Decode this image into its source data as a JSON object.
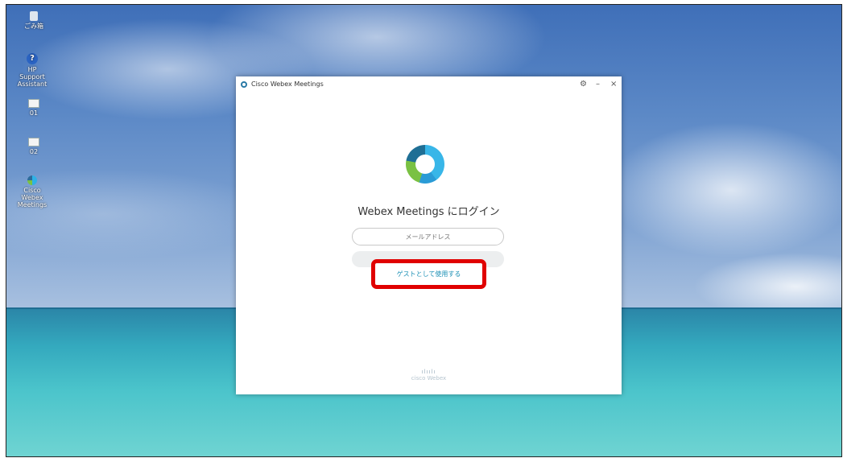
{
  "desktop": {
    "icons": [
      {
        "label": "ごみ箱",
        "icon": "recycle-bin-icon"
      },
      {
        "label": "HP Support Assistant",
        "icon": "help-icon"
      },
      {
        "label": "01",
        "icon": "file-icon"
      },
      {
        "label": "02",
        "icon": "file-icon"
      },
      {
        "label": "Cisco Webex Meetings",
        "icon": "webex-icon"
      }
    ]
  },
  "window": {
    "title": "Cisco Webex Meetings",
    "controls": {
      "settings": "⚙",
      "minimize": "–",
      "close": "×"
    },
    "heading": "Webex Meetings にログイン",
    "email_placeholder": "メールアドレス",
    "email_value": "",
    "guest_button": "ゲストとして使用する",
    "footer_brand": "cisco",
    "footer_product": "Webex",
    "footer_bars": "ılıılı"
  },
  "colors": {
    "accent": "#1a8fb4",
    "highlight": "#e00000"
  }
}
